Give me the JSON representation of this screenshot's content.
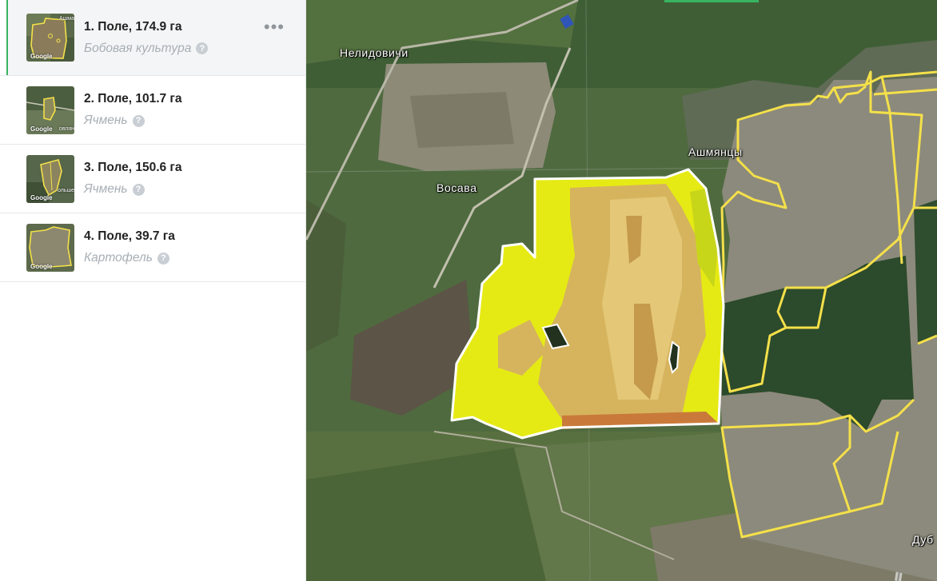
{
  "fields": [
    {
      "title": "1. Поле, 174.9 га",
      "crop": "Бобовая культура",
      "active": true,
      "thumb_watermark": "Google",
      "thumb_place": "Ашма"
    },
    {
      "title": "2. Поле, 101.7 га",
      "crop": "Ячмень",
      "active": false,
      "thumb_watermark": "Google",
      "thumb_place": "овлян"
    },
    {
      "title": "3. Поле, 150.6 га",
      "crop": "Ячмень",
      "active": false,
      "thumb_watermark": "Google",
      "thumb_place": "ольше"
    },
    {
      "title": "4. Поле, 39.7 га",
      "crop": "Картофель",
      "active": false,
      "thumb_watermark": "Google",
      "thumb_place": ""
    }
  ],
  "help_glyph": "?",
  "more_glyph": "•••",
  "map": {
    "places": {
      "nelidovichi": "Нелидовичи",
      "vosava": "Восава",
      "ashmyantsy": "Ашмянцы",
      "dub": "Дуб"
    }
  },
  "colors": {
    "active_accent": "#38b460",
    "field_boundary": "#f4e04a",
    "selected_boundary": "#ffffff",
    "ndvi_yellow": "#e6ea14",
    "ndvi_tan": "#d6b45e",
    "ndvi_brown": "#c59a4c"
  }
}
